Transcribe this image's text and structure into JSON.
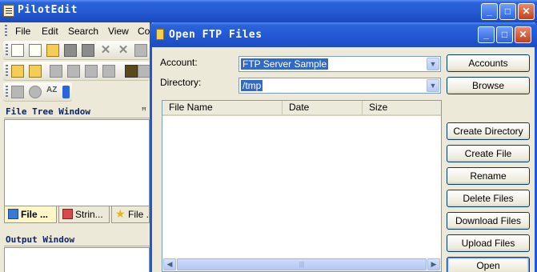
{
  "app": {
    "title": "PilotEdit",
    "menu": [
      "File",
      "Edit",
      "Search",
      "View",
      "Co"
    ]
  },
  "panels": {
    "file_tree_title": "File Tree Window",
    "output_title": "Output Window",
    "tabs": [
      {
        "label": "File ...",
        "icon": "file-tree-icon"
      },
      {
        "label": "Strin...",
        "icon": "string-list-icon"
      },
      {
        "label": "File ...",
        "icon": "favorite-star-icon"
      }
    ]
  },
  "dialog": {
    "title": "Open FTP Files",
    "account_label": "Account:",
    "account_value": "FTP Server Sample",
    "directory_label": "Directory:",
    "directory_value": "/tmp",
    "columns": [
      "File Name",
      "Date",
      "Size"
    ],
    "buttons": {
      "accounts": "Accounts",
      "browse": "Browse",
      "create_directory": "Create Directory",
      "create_file": "Create File",
      "rename": "Rename",
      "delete_files": "Delete Files",
      "download_files": "Download Files",
      "upload_files": "Upload Files",
      "open": "Open"
    }
  },
  "colors": {
    "titlebar": "#2458d2",
    "selection": "#316ac5",
    "close_button": "#c2401b"
  }
}
